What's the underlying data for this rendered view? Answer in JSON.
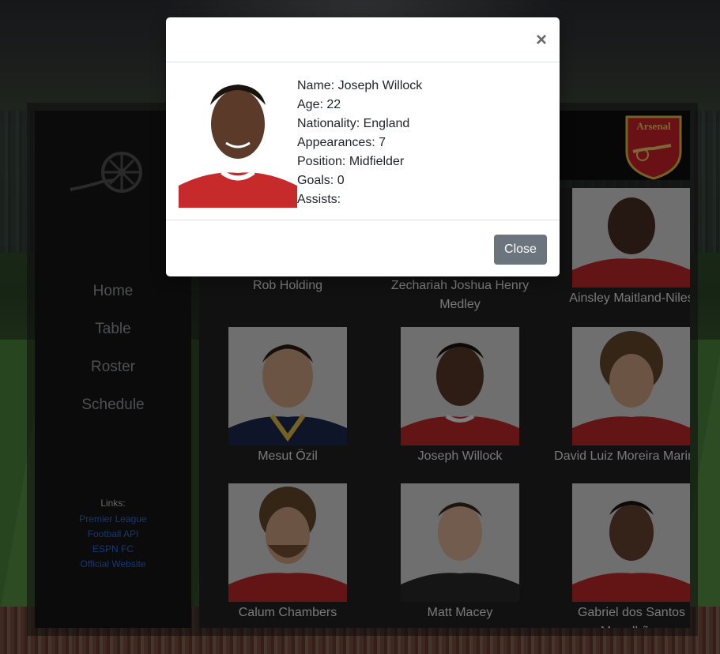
{
  "sidebar": {
    "nav": [
      {
        "label": "Home"
      },
      {
        "label": "Table"
      },
      {
        "label": "Roster"
      },
      {
        "label": "Schedule"
      }
    ],
    "links_title": "Links:",
    "links": [
      {
        "label": "Premier League"
      },
      {
        "label": "Football API"
      },
      {
        "label": "ESPN FC"
      },
      {
        "label": "Official Website"
      }
    ]
  },
  "header": {
    "crest_text": "Arsenal"
  },
  "roster": {
    "players": [
      {
        "name": "Rob Holding"
      },
      {
        "name": "Zechariah Joshua Henry Medley"
      },
      {
        "name": "Ainsley Maitland-Niles"
      },
      {
        "name": "Mesut Özil"
      },
      {
        "name": "Joseph Willock"
      },
      {
        "name": "David Luiz Moreira Marinho"
      },
      {
        "name": "Calum Chambers"
      },
      {
        "name": "Matt Macey"
      },
      {
        "name": "Gabriel dos Santos Magalhães"
      }
    ]
  },
  "modal": {
    "close_symbol": "×",
    "name": "Name: Joseph Willock",
    "age": "Age: 22",
    "nationality": "Nationality: England",
    "appearances": "Appearances: 7",
    "position": "Position: Midfielder",
    "goals": "Goals: 0",
    "assists": "Assists:",
    "close_label": "Close"
  },
  "colors": {
    "arsenal_red": "#d4232b",
    "link_blue": "#2f6fe0",
    "close_button": "#6c757d"
  }
}
